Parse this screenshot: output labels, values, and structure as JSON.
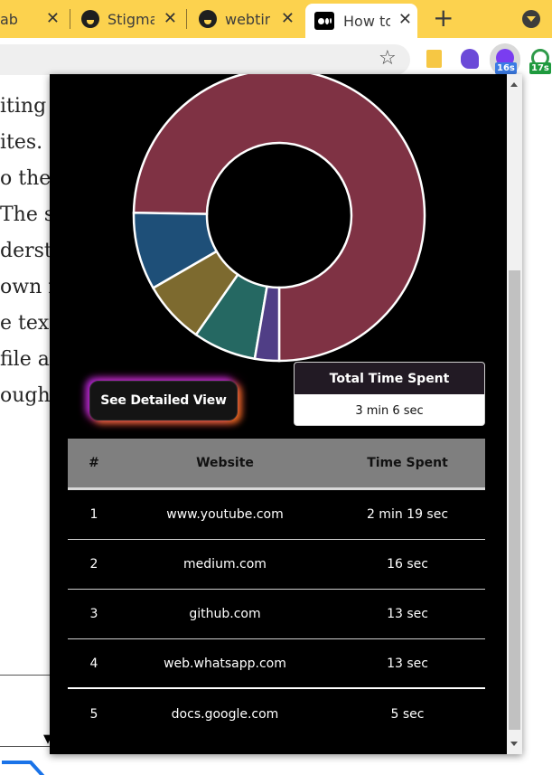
{
  "tabs": [
    {
      "title": "ab",
      "partial": true
    },
    {
      "title": "Stigmat"
    },
    {
      "title": "webtim"
    },
    {
      "title": "How to",
      "active": true
    }
  ],
  "toolbar": {
    "badges": {
      "ext_purple": "16s",
      "ext_green": "17s"
    }
  },
  "article": {
    "lines": [
      "iting",
      "ites. I",
      "o the",
      "The si",
      "dersta",
      "own n",
      "e text",
      "file a",
      "ough a"
    ]
  },
  "popup": {
    "chart_data": {
      "type": "pie",
      "title": "",
      "categories": [
        "www.youtube.com",
        "medium.com",
        "github.com",
        "web.whatsapp.com",
        "docs.google.com"
      ],
      "values": [
        139,
        16,
        13,
        13,
        5
      ],
      "colors": [
        "#7f3244",
        "#1e4f78",
        "#7d6a2f",
        "#256862",
        "#503e86"
      ],
      "legend": "none",
      "donut": true
    },
    "detailed_button": "See Detailed View",
    "total": {
      "header": "Total Time Spent",
      "value": "3 min 6 sec"
    },
    "table": {
      "headers": [
        "#",
        "Website",
        "Time Spent"
      ],
      "rows": [
        [
          "1",
          "www.youtube.com",
          "2 min 19 sec"
        ],
        [
          "2",
          "medium.com",
          "16 sec"
        ],
        [
          "3",
          "github.com",
          "13 sec"
        ],
        [
          "4",
          "web.whatsapp.com",
          "13 sec"
        ],
        [
          "5",
          "docs.google.com",
          "5 sec"
        ]
      ]
    }
  }
}
